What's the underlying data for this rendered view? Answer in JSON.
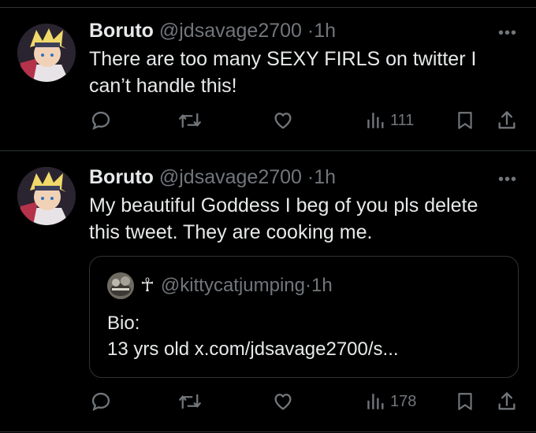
{
  "tweets": [
    {
      "display_name": "Boruto",
      "handle": "@jdsavage2700",
      "time": "1h",
      "text_line1": "There are too many SEXY FIRLS on twitter I",
      "text_line2": "can’t handle this!",
      "views": "111"
    },
    {
      "display_name": "Boruto",
      "handle": "@jdsavage2700",
      "time": "1h",
      "text_line1": "My beautiful Goddess I beg of you pls delete",
      "text_line2": "this tweet. They are cooking me.",
      "views": "178",
      "quote": {
        "display_name": "☥",
        "handle": "@kittycatjumping",
        "time": "1h",
        "line1": "Bio:",
        "line2": "13 yrs old x.com/jdsavage2700/s..."
      }
    }
  ],
  "separator": "·",
  "more_glyph": "•••",
  "colors": {
    "background": "#000000",
    "text": "#e7e9ea",
    "secondary": "#71767b",
    "border": "#2f3336"
  },
  "icons": [
    "reply-icon",
    "retweet-icon",
    "like-icon",
    "views-icon",
    "bookmark-icon",
    "share-icon",
    "more-icon"
  ]
}
